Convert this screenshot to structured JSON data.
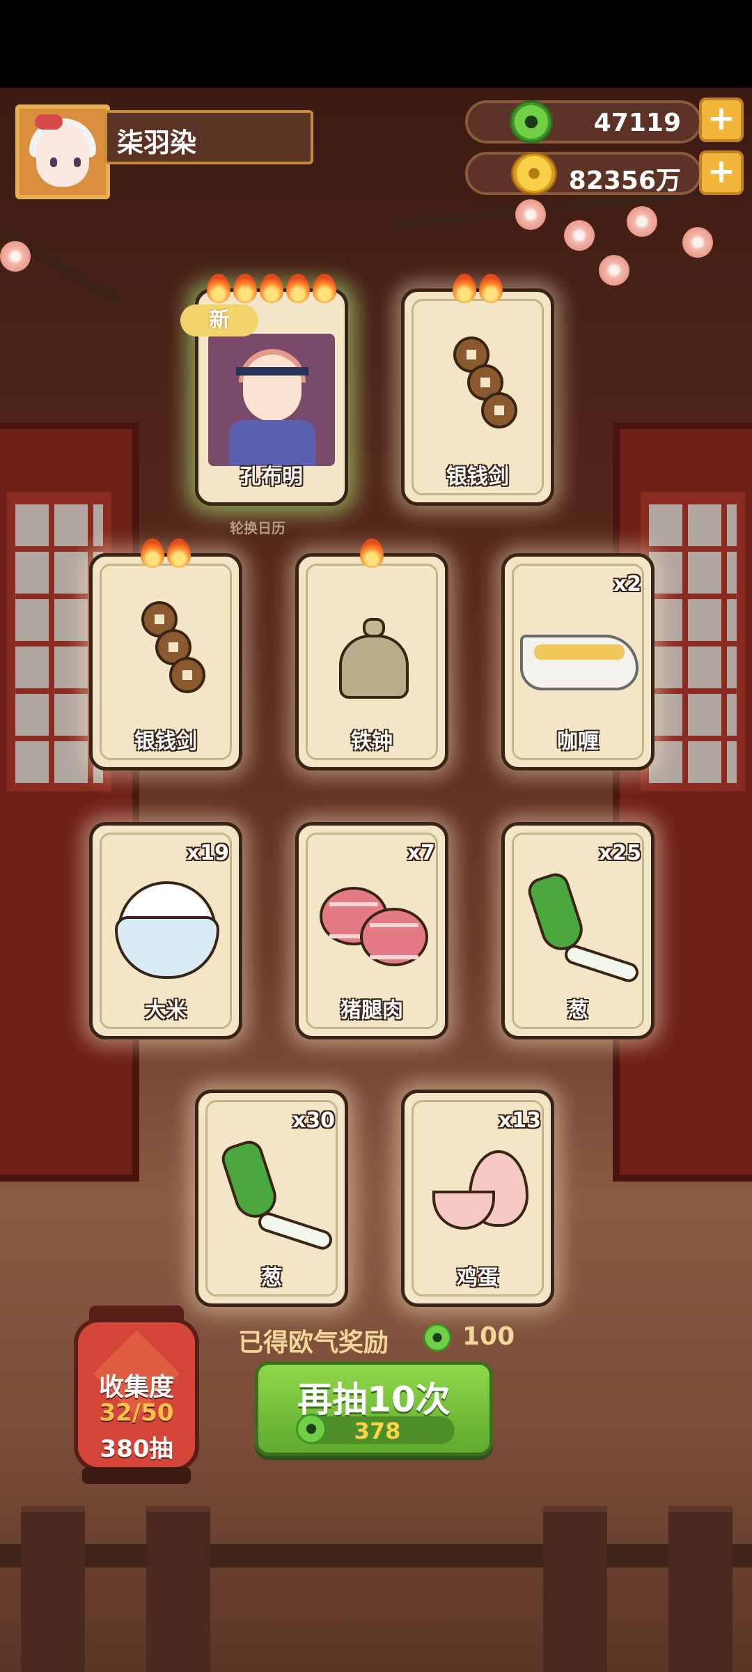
{
  "player": {
    "name": "柒羽染"
  },
  "currencies": [
    {
      "kind": "jade",
      "value": "47119"
    },
    {
      "kind": "gold",
      "value": "82356万"
    }
  ],
  "new_tag": "新",
  "rotation_label": "轮换日历",
  "cards": [
    {
      "name": "孔布明",
      "count": "",
      "flames": 5,
      "is_new": true,
      "art": "character-portrait-icon"
    },
    {
      "name": "银钱剑",
      "count": "",
      "flames": 2,
      "is_new": false,
      "art": "coin-sword-icon"
    },
    {
      "name": "银钱剑",
      "count": "",
      "flames": 2,
      "is_new": false,
      "art": "coin-sword-icon"
    },
    {
      "name": "铁钟",
      "count": "",
      "flames": 1,
      "is_new": false,
      "art": "iron-bell-icon"
    },
    {
      "name": "咖喱",
      "count": "x2",
      "flames": 0,
      "is_new": false,
      "art": "curry-gravy-icon"
    },
    {
      "name": "大米",
      "count": "x19",
      "flames": 0,
      "is_new": false,
      "art": "rice-bowl-icon"
    },
    {
      "name": "猪腿肉",
      "count": "x7",
      "flames": 0,
      "is_new": false,
      "art": "pork-leg-icon"
    },
    {
      "name": "葱",
      "count": "x25",
      "flames": 0,
      "is_new": false,
      "art": "scallion-icon"
    },
    {
      "name": "葱",
      "count": "x30",
      "flames": 0,
      "is_new": false,
      "art": "scallion-icon"
    },
    {
      "name": "鸡蛋",
      "count": "x13",
      "flames": 0,
      "is_new": false,
      "art": "egg-icon"
    }
  ],
  "reward": {
    "label": "已得欧气奖励",
    "value": "100"
  },
  "draw_button": {
    "label": "再抽10次",
    "cost": "378"
  },
  "collection": {
    "title": "收集度",
    "progress": "32/50",
    "draws": "380抽"
  },
  "colors": {
    "accent_green": "#6fbf3a",
    "gold": "#f4b63a",
    "card_bg": "#f3e6c6"
  }
}
